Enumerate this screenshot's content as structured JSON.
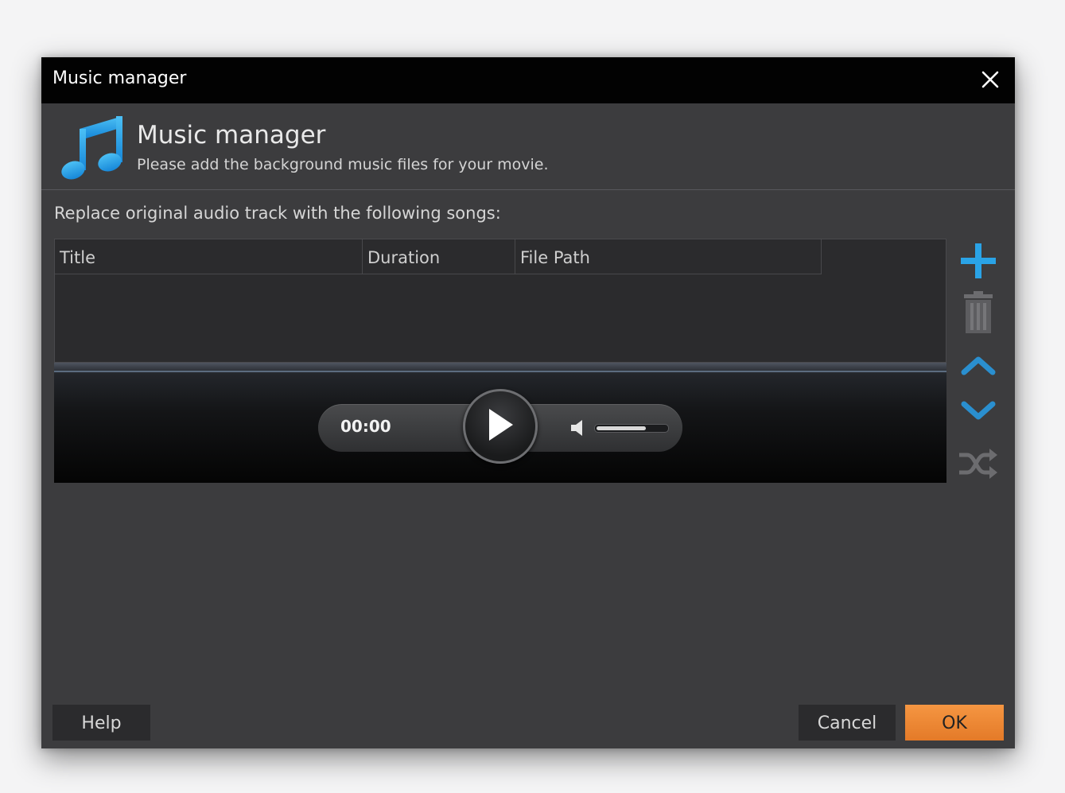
{
  "window": {
    "title": "Music manager"
  },
  "header": {
    "title": "Music manager",
    "subtitle": "Please add the background music files for your movie.",
    "icon": "music-note-icon"
  },
  "main": {
    "replace_label": "Replace original audio track with the following songs:",
    "table": {
      "columns": [
        "Title",
        "Duration",
        "File Path"
      ],
      "rows": []
    }
  },
  "player": {
    "time": "00:00",
    "volume_level": 0.7
  },
  "side_tools": [
    "add-icon",
    "delete-icon",
    "move-up-icon",
    "move-down-icon",
    "shuffle-icon"
  ],
  "footer": {
    "help_label": "Help",
    "cancel_label": "Cancel",
    "ok_label": "OK"
  },
  "colors": {
    "accent_blue": "#2aa3e6",
    "ok_orange": "#f08a35",
    "background": "#3c3c3e"
  }
}
